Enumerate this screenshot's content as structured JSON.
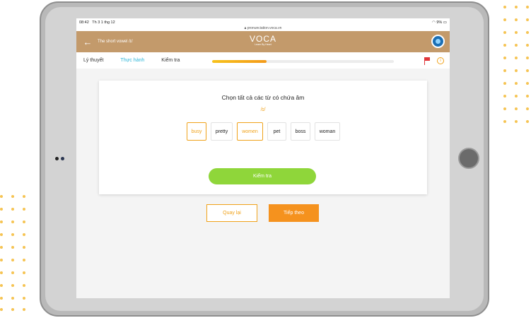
{
  "status_bar": {
    "time": "08:42",
    "date": "Th 3 1 thg 12",
    "battery": "9%"
  },
  "url": "pronunciation.voca.vn",
  "header": {
    "lesson_title": "The short vowel /ɪ/",
    "logo_text": "VOCA",
    "logo_tagline": "Learn By Heart"
  },
  "tabs": [
    {
      "label": "Lý thuyết",
      "active": false
    },
    {
      "label": "Thực hành",
      "active": true
    },
    {
      "label": "Kiểm tra",
      "active": false
    }
  ],
  "progress_percent": 30,
  "exercise": {
    "prompt": "Chọn tất cả các từ có chứa âm",
    "phoneme": "/ɪ/",
    "choices": [
      {
        "word": "busy",
        "selected": true
      },
      {
        "word": "pretty",
        "selected": false
      },
      {
        "word": "women",
        "selected": true
      },
      {
        "word": "pet",
        "selected": false
      },
      {
        "word": "boss",
        "selected": false
      },
      {
        "word": "woman",
        "selected": false
      }
    ],
    "check_label": "Kiểm tra"
  },
  "navigation": {
    "back_label": "Quay lại",
    "next_label": "Tiếp theo"
  },
  "colors": {
    "header_bg": "#c39a6b",
    "accent_orange": "#f0a21a",
    "active_tab": "#2bb5d8",
    "check_button": "#8fd63a",
    "next_button": "#f5921e"
  },
  "icons": {
    "back": "arrow-left-icon",
    "avatar": "user-avatar",
    "report": "flag-icon",
    "info": "info-icon"
  }
}
